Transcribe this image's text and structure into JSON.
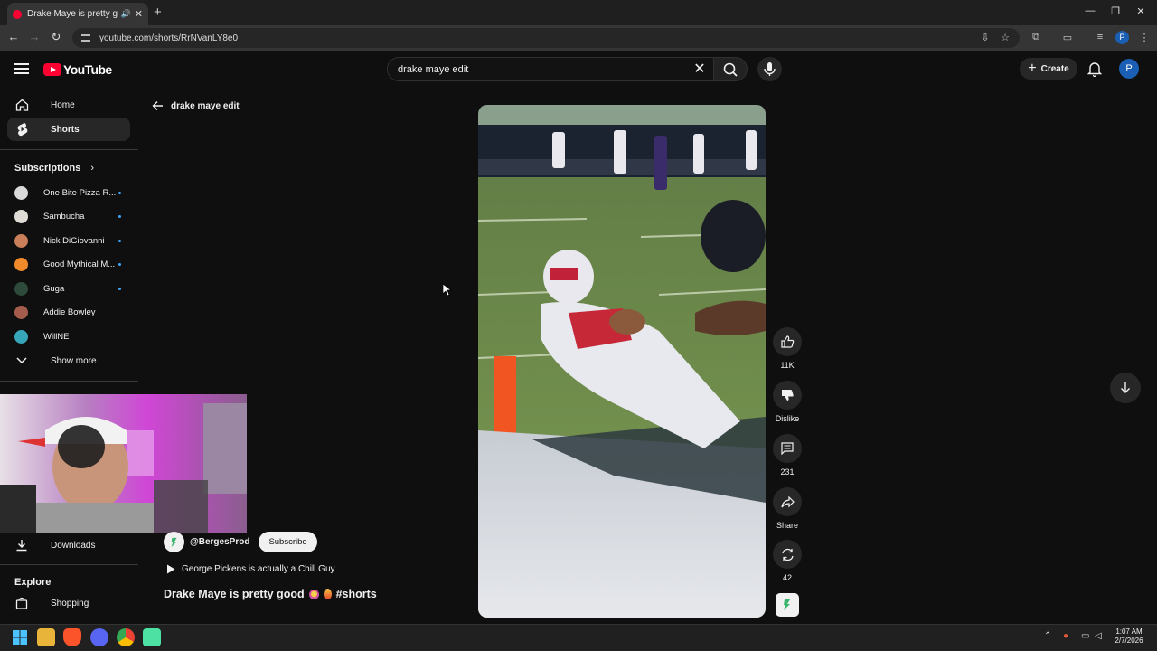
{
  "browser": {
    "tab_title": "Drake Maye is pretty good 😳🔥",
    "url": "youtube.com/shorts/RrNVanLY8e0"
  },
  "header": {
    "logo_text": "YouTube",
    "search_value": "drake maye edit",
    "create_label": "Create",
    "avatar_letter": "P"
  },
  "sidebar": {
    "home_label": "Home",
    "shorts_label": "Shorts",
    "subscriptions_label": "Subscriptions",
    "subscriptions": [
      {
        "name": "One Bite Pizza R...",
        "color": "#d9d9d9"
      },
      {
        "name": "Sambucha",
        "color": "#e0ddd6"
      },
      {
        "name": "Nick DiGiovanni",
        "color": "#c97f5a"
      },
      {
        "name": "Good Mythical M...",
        "color": "#f08a2a"
      },
      {
        "name": "Guga",
        "color": "#2e4a3a"
      },
      {
        "name": "Addie Bowley",
        "color": "#a45c4c"
      },
      {
        "name": "WillNE",
        "color": "#36a6b8"
      }
    ],
    "show_more_label": "Show more",
    "downloads_label": "Downloads",
    "explore_label": "Explore",
    "shopping_label": "Shopping"
  },
  "main": {
    "back_label": "drake maye edit",
    "actions": {
      "like_count": "11K",
      "dislike_label": "Dislike",
      "comment_count": "231",
      "share_label": "Share",
      "remix_count": "42"
    },
    "channel_handle": "@BergesProd",
    "subscribe_label": "Subscribe",
    "playlist_label": "George Pickens is actually a Chill Guy",
    "short_title": "Drake Maye is pretty good",
    "short_hashtag": "#shorts"
  },
  "taskbar": {
    "time": "1:07 AM",
    "date": "2/7/2026"
  },
  "colors": {
    "yt_red": "#ff0033",
    "accent_blue": "#3ea6ff",
    "bg": "#0f0f0f"
  }
}
